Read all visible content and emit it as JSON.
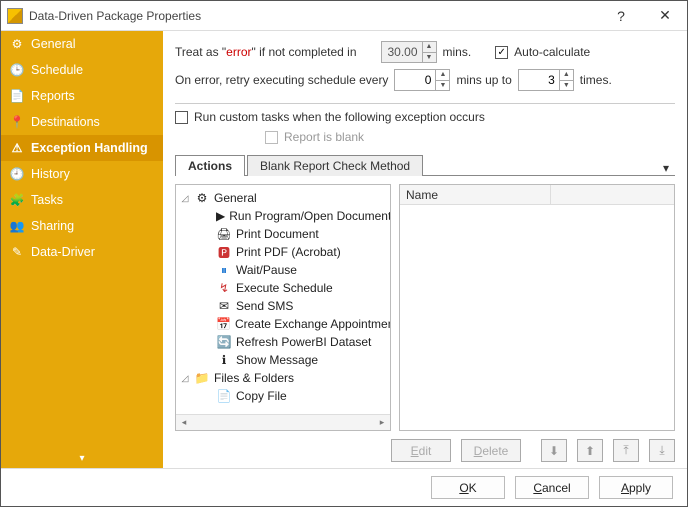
{
  "window": {
    "title": "Data-Driven Package Properties"
  },
  "sidebar": {
    "items": [
      {
        "label": "General"
      },
      {
        "label": "Schedule"
      },
      {
        "label": "Reports"
      },
      {
        "label": "Destinations"
      },
      {
        "label": "Exception Handling"
      },
      {
        "label": "History"
      },
      {
        "label": "Tasks"
      },
      {
        "label": "Sharing"
      },
      {
        "label": "Data-Driver"
      }
    ]
  },
  "exception": {
    "treat_as_label_pre": "Treat as \"",
    "treat_as_error": "error",
    "treat_as_label_post": "\" if not completed in",
    "treat_as_value": "30.00",
    "mins_label": "mins.",
    "auto_calc_label": "Auto-calculate",
    "retry_label": "On error, retry  executing schedule every",
    "retry_every_value": "0",
    "mins_up_to_label": "mins up to",
    "retry_times_value": "3",
    "times_label": "times.",
    "custom_tasks_label": "Run custom tasks when the following exception occurs",
    "report_blank_label": "Report is blank"
  },
  "tabs": {
    "actions": "Actions",
    "blank_method": "Blank Report Check Method"
  },
  "tree": {
    "groups": [
      {
        "label": "General",
        "items": [
          "Run Program/Open Document",
          "Print Document",
          "Print PDF (Acrobat)",
          "Wait/Pause",
          "Execute Schedule",
          "Send SMS",
          "Create Exchange Appointment",
          "Refresh PowerBI Dataset",
          "Show Message"
        ]
      },
      {
        "label": "Files & Folders",
        "items": [
          "Copy File"
        ]
      }
    ]
  },
  "name_col": "Name",
  "buttons": {
    "edit": "Edit",
    "delete": "Delete",
    "ok": "OK",
    "cancel": "Cancel",
    "apply": "Apply"
  }
}
